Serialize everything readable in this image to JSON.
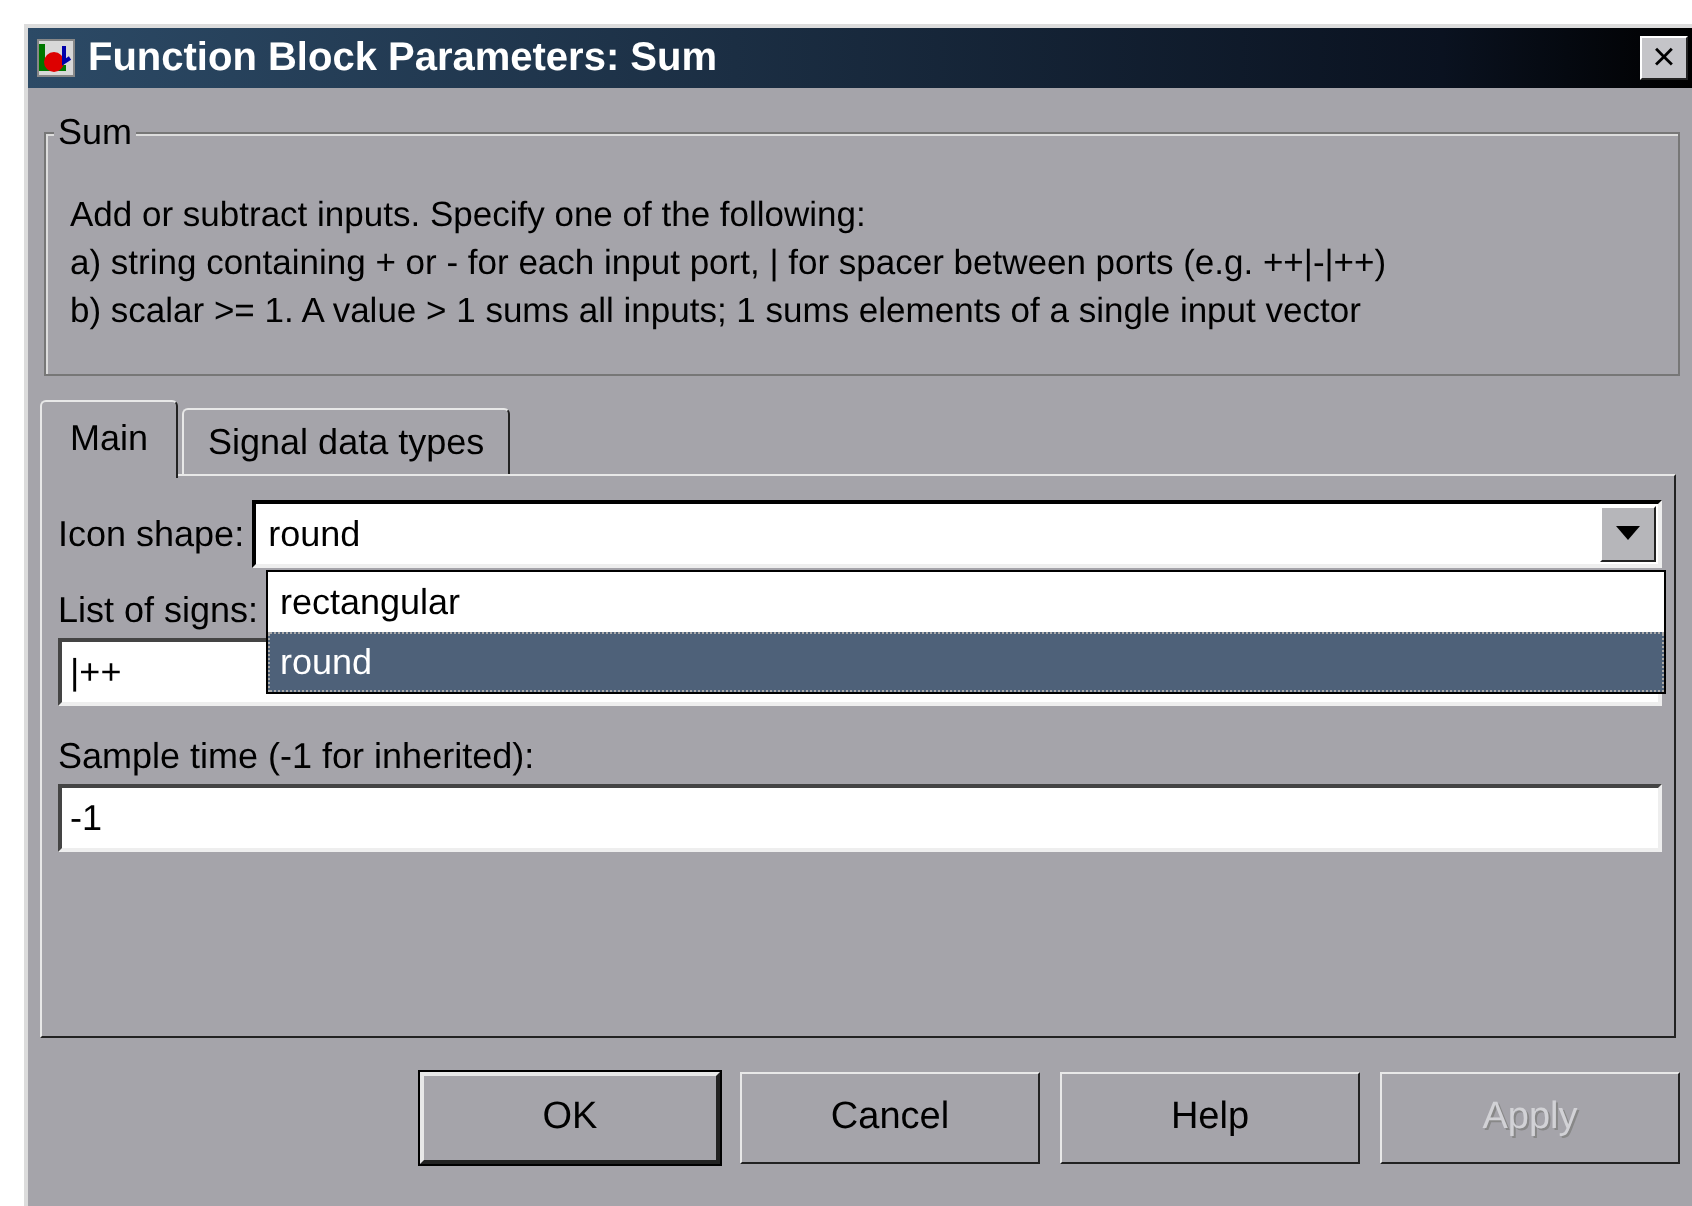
{
  "window": {
    "title": "Function Block Parameters: Sum",
    "close": "×"
  },
  "group": {
    "title": "Sum",
    "lines": [
      "Add or subtract inputs.  Specify one of the following:",
      "a) string containing + or - for each input port, | for spacer between ports (e.g. ++|-|++)",
      "b) scalar >= 1. A value > 1 sums all inputs; 1 sums elements of a single input vector"
    ]
  },
  "tabs": [
    {
      "label": "Main",
      "selected": true
    },
    {
      "label": "Signal data types",
      "selected": false
    }
  ],
  "icon_shape": {
    "label": "Icon shape:",
    "value": "round",
    "expanded": true,
    "options": [
      {
        "label": "rectangular",
        "selected": false
      },
      {
        "label": "round",
        "selected": true
      }
    ]
  },
  "list_of_signs": {
    "label": "List of signs:",
    "value": "|++"
  },
  "sample_time": {
    "label": "Sample time (-1 for inherited):",
    "value": "-1"
  },
  "buttons": [
    {
      "label": "OK",
      "default": true,
      "disabled": false
    },
    {
      "label": "Cancel",
      "default": false,
      "disabled": false
    },
    {
      "label": "Help",
      "default": false,
      "disabled": false
    },
    {
      "label": "Apply",
      "default": false,
      "disabled": true
    }
  ]
}
